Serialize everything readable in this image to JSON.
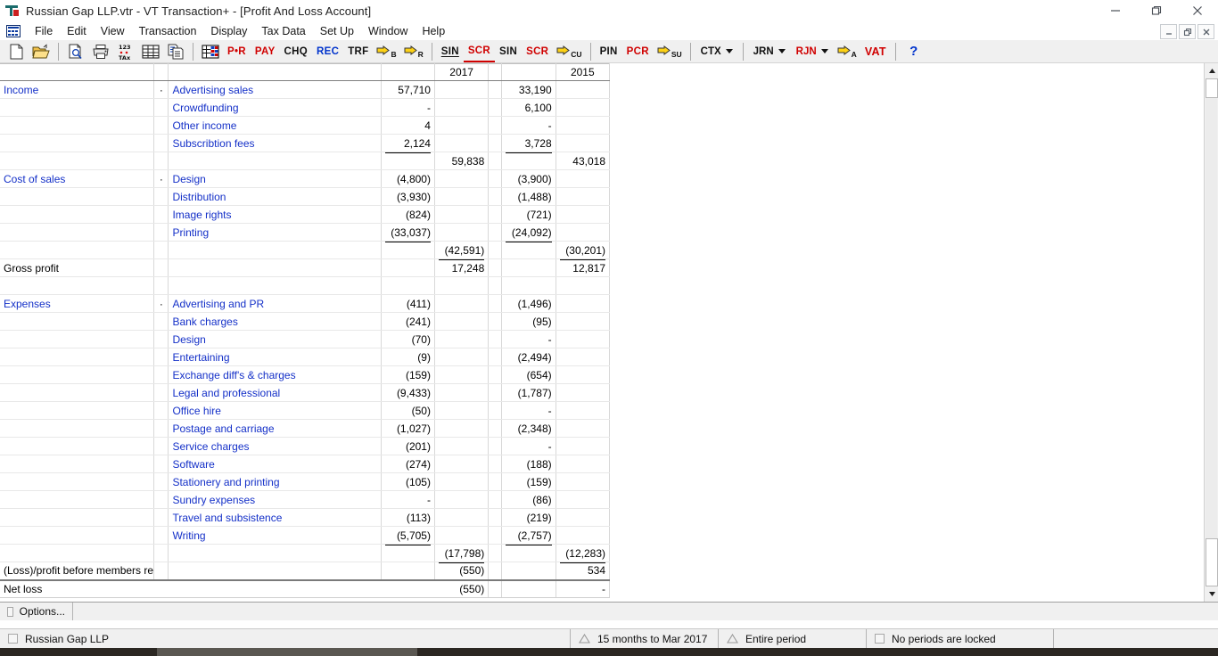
{
  "window": {
    "title": "Russian Gap LLP.vtr - VT Transaction+ - [Profit And Loss Account]",
    "app_icon": "vt-transaction-icon",
    "minimize": "minimize-icon",
    "maximize": "maximize-icon",
    "close": "close-icon",
    "mdi_minimize": "mdi-minimize-icon",
    "mdi_restore": "mdi-restore-icon",
    "mdi_close": "mdi-close-icon"
  },
  "menu": {
    "icon": "grid-menu-icon",
    "items": [
      {
        "label": "File"
      },
      {
        "label": "Edit"
      },
      {
        "label": "View"
      },
      {
        "label": "Transaction"
      },
      {
        "label": "Display"
      },
      {
        "label": "Tax Data"
      },
      {
        "label": "Set Up"
      },
      {
        "label": "Window"
      },
      {
        "label": "Help"
      }
    ]
  },
  "toolbar": {
    "groups": [
      {
        "buttons": [
          {
            "type": "icon",
            "name": "new-document-icon",
            "label": ""
          },
          {
            "type": "icon",
            "name": "open-folder-icon",
            "label": ""
          }
        ]
      },
      {
        "buttons": [
          {
            "type": "icon",
            "name": "print-preview-icon",
            "label": ""
          },
          {
            "type": "icon",
            "name": "print-icon",
            "label": ""
          },
          {
            "type": "icon",
            "name": "tax-123-icon",
            "label": ""
          },
          {
            "type": "icon",
            "name": "table-grid-icon",
            "label": ""
          },
          {
            "type": "icon",
            "name": "copy-icon",
            "label": ""
          }
        ]
      },
      {
        "buttons": [
          {
            "type": "icon",
            "name": "spreadsheet-color-icon",
            "label": ""
          },
          {
            "type": "text",
            "name": "pay-receipt-button",
            "label": "P•R",
            "color": "red"
          },
          {
            "type": "text",
            "name": "pay-button",
            "label": "PAY",
            "color": "red"
          },
          {
            "type": "text",
            "name": "cheque-button",
            "label": "CHQ",
            "color": "black"
          },
          {
            "type": "text",
            "name": "receipt-button",
            "label": "REC",
            "color": "blue"
          },
          {
            "type": "text",
            "name": "transfer-button",
            "label": "TRF",
            "color": "black"
          },
          {
            "type": "arrow",
            "name": "arrow-b-icon",
            "label": "B"
          },
          {
            "type": "arrow",
            "name": "arrow-r-icon",
            "label": "R"
          }
        ]
      },
      {
        "buttons": [
          {
            "type": "text",
            "name": "sales-invoice-button",
            "label": "SIN",
            "color": "black",
            "style": "underline"
          },
          {
            "type": "text",
            "name": "sales-credit-button",
            "label": "SCR",
            "color": "red",
            "style": "underline-red"
          },
          {
            "type": "text",
            "name": "sales-invoice-2-button",
            "label": "SIN",
            "color": "black"
          },
          {
            "type": "text",
            "name": "sales-credit-2-button",
            "label": "SCR",
            "color": "red"
          },
          {
            "type": "arrow",
            "name": "arrow-cu-icon",
            "label": "CU"
          }
        ]
      },
      {
        "buttons": [
          {
            "type": "text",
            "name": "purchase-invoice-button",
            "label": "PIN",
            "color": "black"
          },
          {
            "type": "text",
            "name": "purchase-credit-button",
            "label": "PCR",
            "color": "red"
          },
          {
            "type": "arrow",
            "name": "arrow-su-icon",
            "label": "SU"
          }
        ]
      },
      {
        "buttons": [
          {
            "type": "combo",
            "name": "ctx-dropdown",
            "label": "CTX",
            "color": "black"
          }
        ]
      },
      {
        "buttons": [
          {
            "type": "combo",
            "name": "jrn-dropdown",
            "label": "JRN",
            "color": "black"
          },
          {
            "type": "combo",
            "name": "rjn-dropdown",
            "label": "RJN",
            "color": "red"
          },
          {
            "type": "arrow",
            "name": "arrow-a-icon",
            "label": "A"
          },
          {
            "type": "text",
            "name": "vat-button",
            "label": "VAT",
            "color": "red"
          }
        ]
      },
      {
        "buttons": [
          {
            "type": "text",
            "name": "help-button",
            "label": "?",
            "color": "blue"
          }
        ]
      }
    ]
  },
  "report": {
    "columns": [
      "",
      "",
      "",
      "",
      "2017",
      "",
      "",
      "2015"
    ],
    "rows": [
      {
        "kind": "header",
        "cells": [
          "",
          "",
          "",
          "",
          "2017",
          "",
          "",
          "2015"
        ]
      },
      {
        "kind": "detail",
        "cells": [
          "Income",
          "·",
          "Advertising sales",
          "57,710",
          "",
          "",
          "33,190",
          ""
        ],
        "link_cols": [
          0,
          2
        ]
      },
      {
        "kind": "detail",
        "cells": [
          "",
          "",
          "Crowdfunding",
          "-",
          "",
          "",
          "6,100",
          ""
        ],
        "link_cols": [
          2
        ]
      },
      {
        "kind": "detail",
        "cells": [
          "",
          "",
          "Other income",
          "4",
          "",
          "",
          "-",
          ""
        ],
        "link_cols": [
          2
        ]
      },
      {
        "kind": "detail",
        "cells": [
          "",
          "",
          "Subscribtion fees",
          "2,124",
          "",
          "",
          "3,728",
          ""
        ],
        "link_cols": [
          2
        ],
        "rule_below": [
          3,
          6
        ]
      },
      {
        "kind": "total",
        "cells": [
          "",
          "",
          "",
          "",
          "59,838",
          "",
          "",
          "43,018"
        ]
      },
      {
        "kind": "detail",
        "cells": [
          "Cost of sales",
          "·",
          "Design",
          "(4,800)",
          "",
          "",
          "(3,900)",
          ""
        ],
        "link_cols": [
          0,
          2
        ]
      },
      {
        "kind": "detail",
        "cells": [
          "",
          "",
          "Distribution",
          "(3,930)",
          "",
          "",
          "(1,488)",
          ""
        ],
        "link_cols": [
          2
        ]
      },
      {
        "kind": "detail",
        "cells": [
          "",
          "",
          "Image rights",
          "(824)",
          "",
          "",
          "(721)",
          ""
        ],
        "link_cols": [
          2
        ]
      },
      {
        "kind": "detail",
        "cells": [
          "",
          "",
          "Printing",
          "(33,037)",
          "",
          "",
          "(24,092)",
          ""
        ],
        "link_cols": [
          2
        ],
        "rule_below": [
          3,
          6
        ]
      },
      {
        "kind": "total",
        "cells": [
          "",
          "",
          "",
          "",
          "(42,591)",
          "",
          "",
          "(30,201)"
        ],
        "rule_below": [
          4,
          7
        ]
      },
      {
        "kind": "total",
        "cells": [
          "Gross profit",
          "",
          "",
          "",
          "17,248",
          "",
          "",
          "12,817"
        ]
      },
      {
        "kind": "spacer",
        "cells": [
          "",
          "",
          "",
          "",
          "",
          "",
          "",
          ""
        ]
      },
      {
        "kind": "detail",
        "cells": [
          "Expenses",
          "·",
          "Advertising and PR",
          "(411)",
          "",
          "",
          "(1,496)",
          ""
        ],
        "link_cols": [
          0,
          2
        ]
      },
      {
        "kind": "detail",
        "cells": [
          "",
          "",
          "Bank charges",
          "(241)",
          "",
          "",
          "(95)",
          ""
        ],
        "link_cols": [
          2
        ]
      },
      {
        "kind": "detail",
        "cells": [
          "",
          "",
          "Design",
          "(70)",
          "",
          "",
          "-",
          ""
        ],
        "link_cols": [
          2
        ]
      },
      {
        "kind": "detail",
        "cells": [
          "",
          "",
          "Entertaining",
          "(9)",
          "",
          "",
          "(2,494)",
          ""
        ],
        "link_cols": [
          2
        ]
      },
      {
        "kind": "detail",
        "cells": [
          "",
          "",
          "Exchange diff's & charges",
          "(159)",
          "",
          "",
          "(654)",
          ""
        ],
        "link_cols": [
          2
        ]
      },
      {
        "kind": "detail",
        "cells": [
          "",
          "",
          "Legal and professional",
          "(9,433)",
          "",
          "",
          "(1,787)",
          ""
        ],
        "link_cols": [
          2
        ]
      },
      {
        "kind": "detail",
        "cells": [
          "",
          "",
          "Office hire",
          "(50)",
          "",
          "",
          "-",
          ""
        ],
        "link_cols": [
          2
        ]
      },
      {
        "kind": "detail",
        "cells": [
          "",
          "",
          "Postage and carriage",
          "(1,027)",
          "",
          "",
          "(2,348)",
          ""
        ],
        "link_cols": [
          2
        ]
      },
      {
        "kind": "detail",
        "cells": [
          "",
          "",
          "Service charges",
          "(201)",
          "",
          "",
          "-",
          ""
        ],
        "link_cols": [
          2
        ]
      },
      {
        "kind": "detail",
        "cells": [
          "",
          "",
          "Software",
          "(274)",
          "",
          "",
          "(188)",
          ""
        ],
        "link_cols": [
          2
        ]
      },
      {
        "kind": "detail",
        "cells": [
          "",
          "",
          "Stationery and printing",
          "(105)",
          "",
          "",
          "(159)",
          ""
        ],
        "link_cols": [
          2
        ]
      },
      {
        "kind": "detail",
        "cells": [
          "",
          "",
          "Sundry expenses",
          "-",
          "",
          "",
          "(86)",
          ""
        ],
        "link_cols": [
          2
        ]
      },
      {
        "kind": "detail",
        "cells": [
          "",
          "",
          "Travel and subsistence",
          "(113)",
          "",
          "",
          "(219)",
          ""
        ],
        "link_cols": [
          2
        ]
      },
      {
        "kind": "detail",
        "cells": [
          "",
          "",
          "Writing",
          "(5,705)",
          "",
          "",
          "(2,757)",
          ""
        ],
        "link_cols": [
          2
        ],
        "rule_below": [
          3,
          6
        ]
      },
      {
        "kind": "total",
        "cells": [
          "",
          "",
          "",
          "",
          "(17,798)",
          "",
          "",
          "(12,283)"
        ],
        "rule_below": [
          4,
          7
        ]
      },
      {
        "kind": "total",
        "cells": [
          "(Loss)/profit before members remur",
          "",
          "",
          "",
          "(550)",
          "",
          "",
          "534"
        ]
      },
      {
        "kind": "net",
        "cells": [
          "Net loss",
          "",
          "",
          "",
          "(550)",
          "",
          "",
          "-"
        ]
      }
    ]
  },
  "scrollbar": {
    "up_arrow": "scroll-up-arrow-icon",
    "down_arrow": "scroll-down-arrow-icon",
    "thumb": "scroll-thumb"
  },
  "options_bar": {
    "button": {
      "icon": "options-square-icon",
      "label": "Options..."
    }
  },
  "status_bar": {
    "cells": [
      {
        "icon": "company-square-icon",
        "label": "Russian Gap LLP"
      },
      {
        "icon": "period-triangle-icon",
        "label": "15 months to Mar 2017"
      },
      {
        "icon": "period-triangle-icon",
        "label": "Entire period"
      },
      {
        "icon": "lock-square-icon",
        "label": "No periods are locked"
      }
    ]
  },
  "colors": {
    "link": "#1430c8",
    "toolbar_red": "#d00000",
    "toolbar_blue": "#0033cc",
    "chrome": "#f0f0f0"
  }
}
